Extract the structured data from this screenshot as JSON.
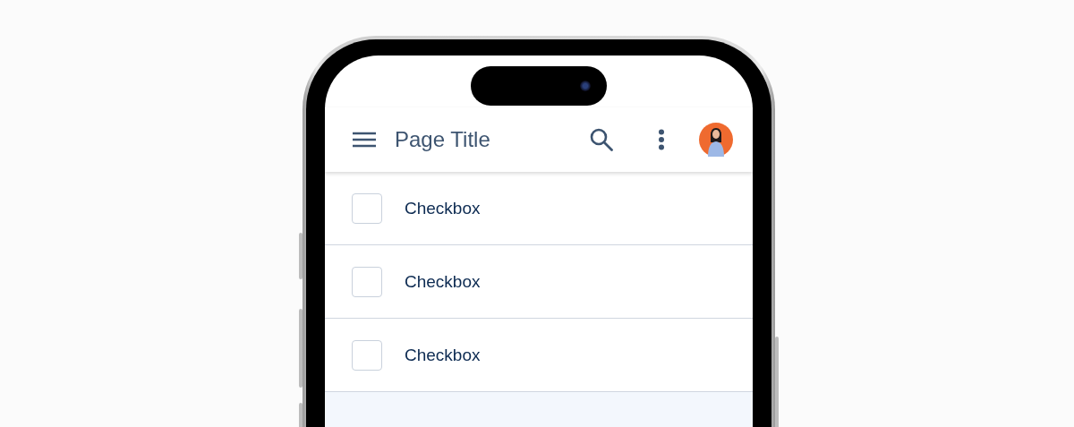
{
  "app_bar": {
    "title": "Page Title"
  },
  "items": [
    {
      "label": "Checkbox",
      "checked": false
    },
    {
      "label": "Checkbox",
      "checked": false
    },
    {
      "label": "Checkbox",
      "checked": false
    }
  ]
}
